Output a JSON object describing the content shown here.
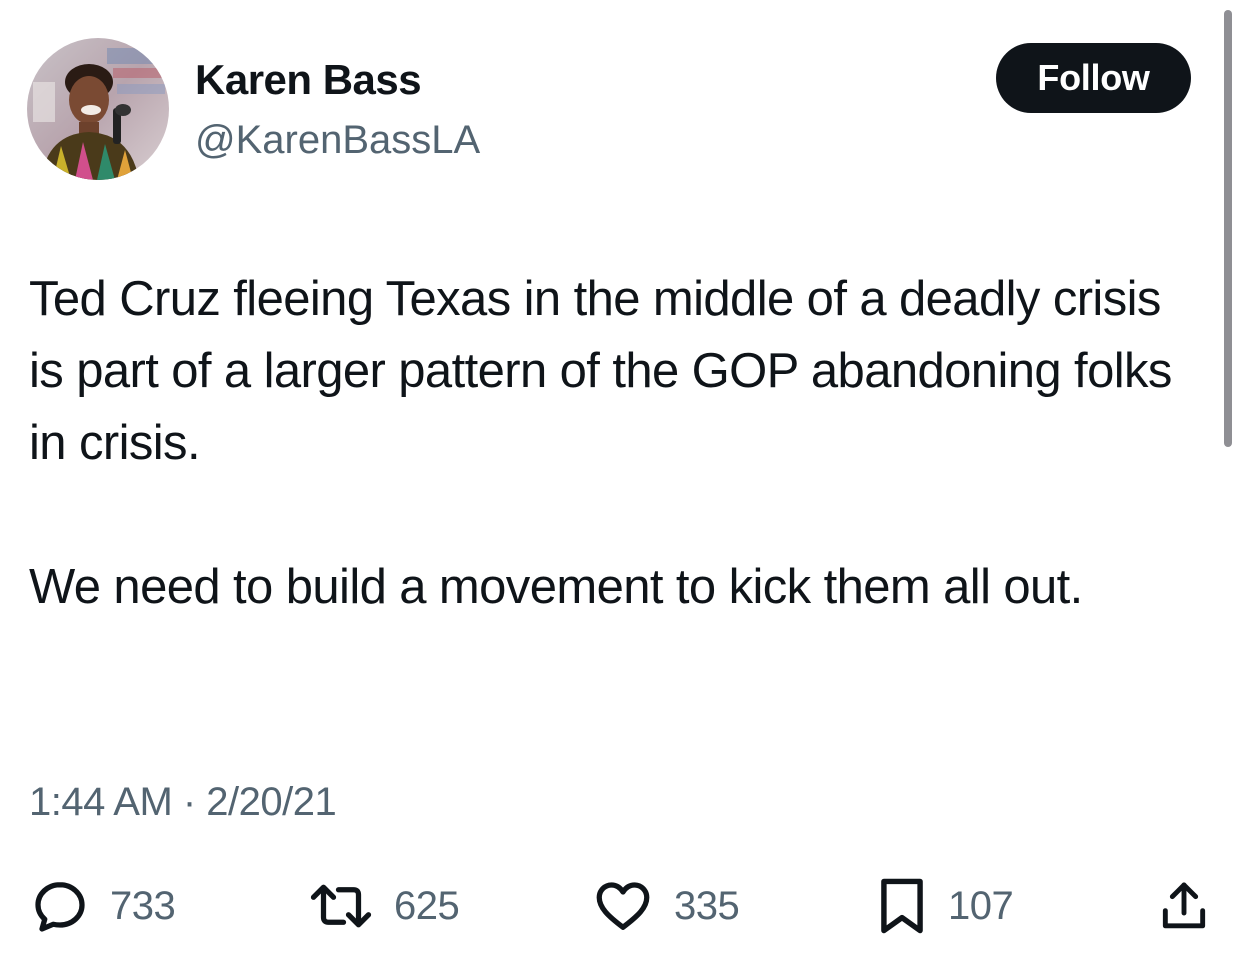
{
  "author": {
    "name": "Karen Bass",
    "handle": "@KarenBassLA",
    "avatar_icon": "profile-photo"
  },
  "follow_button": {
    "label": "Follow"
  },
  "tweet": {
    "paragraphs": [
      "Ted Cruz fleeing Texas in the middle of a deadly crisis is part of a larger pattern of the GOP abandoning folks in crisis.",
      "We need to build a movement to kick them all out."
    ],
    "timestamp": "1:44 AM · 2/20/21"
  },
  "actions": {
    "reply": {
      "icon": "reply-icon",
      "count": "733"
    },
    "retweet": {
      "icon": "retweet-icon",
      "count": "625"
    },
    "like": {
      "icon": "heart-icon",
      "count": "335"
    },
    "bookmark": {
      "icon": "bookmark-icon",
      "count": "107"
    },
    "share": {
      "icon": "share-icon"
    }
  },
  "colors": {
    "text": "#0f1419",
    "secondary": "#536471",
    "button_bg": "#0f1419",
    "button_text": "#ffffff"
  }
}
